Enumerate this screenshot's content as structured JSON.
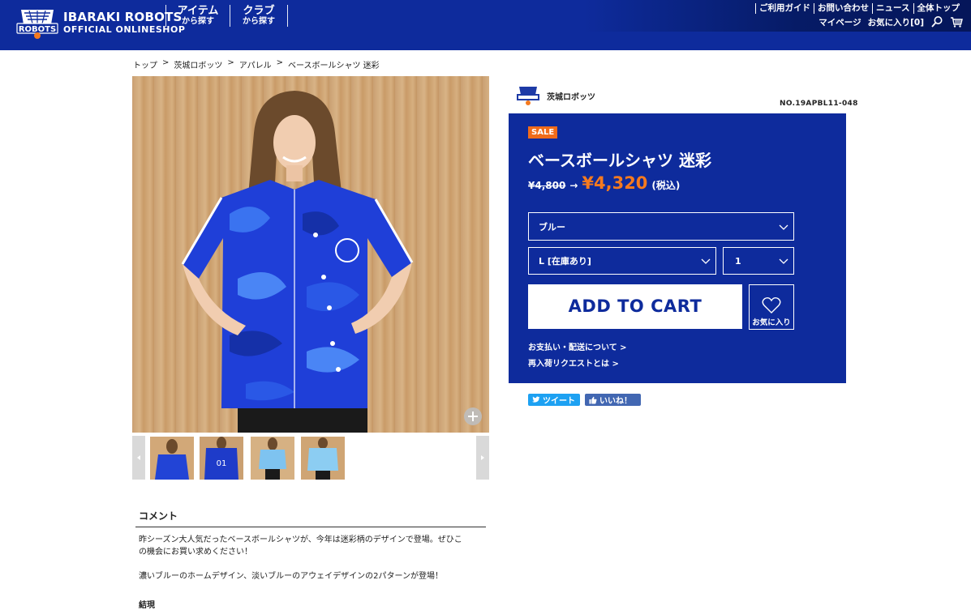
{
  "header": {
    "logo_line1": "IBARAKI ROBOTS",
    "logo_line2": "OFFICIAL ONLINESHOP",
    "logo_mark_text": "ROBOTS",
    "nav": [
      {
        "line1": "アイテム",
        "line2": "から探す"
      },
      {
        "line1": "クラブ",
        "line2": "から探す"
      }
    ],
    "util_links": [
      "ご利用ガイド",
      "お問い合わせ",
      "ニュース",
      "全体トップ"
    ],
    "mypage": "マイページ",
    "favorites": "お気に入り[0]",
    "brand_color": "#0e2b9c"
  },
  "breadcrumb": [
    "トップ",
    "茨城ロボッツ",
    "アパレル",
    "ベースボールシャツ 迷彩"
  ],
  "breadcrumb_sep": ">",
  "product": {
    "club_name": "茨城ロボッツ",
    "product_no": "NO.19APBL11-048",
    "sale_badge": "SALE",
    "title": "ベースボールシャツ 迷彩",
    "old_price": "¥4,800",
    "arrow": "→",
    "new_price": "¥4,320",
    "tax": "(税込)",
    "color_select": "ブルー",
    "size_select": "L [在庫あり]",
    "qty_select": "1",
    "add_to_cart": "ADD TO CART",
    "favorite_label": "お気に入り",
    "link_payment": "お支払い・配送について >",
    "link_restock": "再入荷リクエストとは >",
    "accent_color": "#f57a1f"
  },
  "social": {
    "tweet": "ツイート",
    "like": "いいね！"
  },
  "comment": {
    "heading": "コメント",
    "paragraph1_line1": "昨シーズン大人気だったベースボールシャツが、今年は迷彩柄のデザインで登場。ぜひこ",
    "paragraph1_line2": "の機会にお買い求めください！",
    "paragraph2": "濃いブルーのホームデザイン、淡いブルーのアウェイデザインの2パターンが登場！",
    "subheading": "結現"
  },
  "thumbnails": [
    "thumb-1",
    "thumb-2",
    "thumb-3",
    "thumb-4"
  ]
}
